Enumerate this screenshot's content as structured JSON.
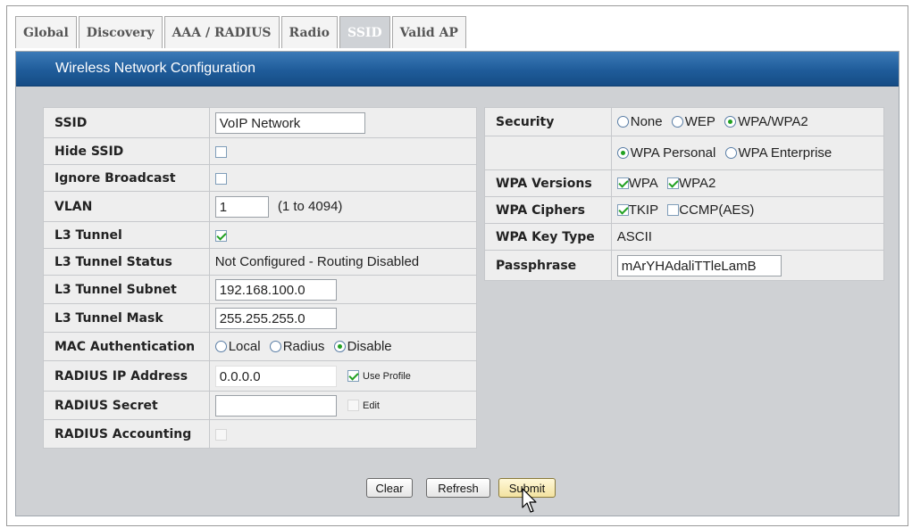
{
  "tabs": [
    {
      "label": "Global",
      "active": false
    },
    {
      "label": "Discovery",
      "active": false
    },
    {
      "label": "AAA / RADIUS",
      "active": false
    },
    {
      "label": "Radio",
      "active": false
    },
    {
      "label": "SSID",
      "active": true
    },
    {
      "label": "Valid AP",
      "active": false
    }
  ],
  "panel_title": "Wireless Network Configuration",
  "left": {
    "ssid": {
      "label": "SSID",
      "value": "VoIP Network"
    },
    "hide_ssid": {
      "label": "Hide SSID",
      "checked": false
    },
    "ignore_broadcast": {
      "label": "Ignore Broadcast",
      "checked": false
    },
    "vlan": {
      "label": "VLAN",
      "value": "1",
      "range": "(1 to 4094)"
    },
    "l3_tunnel": {
      "label": "L3 Tunnel",
      "checked": true
    },
    "l3_tunnel_status": {
      "label": "L3 Tunnel Status",
      "value": "Not Configured - Routing Disabled"
    },
    "l3_tunnel_subnet": {
      "label": "L3 Tunnel Subnet",
      "value": "192.168.100.0"
    },
    "l3_tunnel_mask": {
      "label": "L3 Tunnel Mask",
      "value": "255.255.255.0"
    },
    "mac_auth": {
      "label": "MAC Authentication",
      "options": [
        "Local",
        "Radius",
        "Disable"
      ],
      "selected": "Disable"
    },
    "radius_ip": {
      "label": "RADIUS IP Address",
      "value": "0.0.0.0",
      "use_profile_label": "Use Profile",
      "use_profile_checked": true
    },
    "radius_secret": {
      "label": "RADIUS Secret",
      "value": "",
      "edit_label": "Edit",
      "edit_checked": false
    },
    "radius_accounting": {
      "label": "RADIUS Accounting",
      "checked": false
    }
  },
  "right": {
    "security": {
      "label": "Security",
      "options": [
        "None",
        "WEP",
        "WPA/WPA2"
      ],
      "selected": "WPA/WPA2",
      "modes": [
        "WPA Personal",
        "WPA Enterprise"
      ],
      "mode_selected": "WPA Personal"
    },
    "wpa_versions": {
      "label": "WPA Versions",
      "options": [
        {
          "label": "WPA",
          "checked": true
        },
        {
          "label": "WPA2",
          "checked": true
        }
      ]
    },
    "wpa_ciphers": {
      "label": "WPA Ciphers",
      "options": [
        {
          "label": "TKIP",
          "checked": true
        },
        {
          "label": "CCMP(AES)",
          "checked": false
        }
      ]
    },
    "wpa_key_type": {
      "label": "WPA Key Type",
      "value": "ASCII"
    },
    "passphrase": {
      "label": "Passphrase",
      "value": "mArYHAdaliTTleLamB"
    }
  },
  "buttons": {
    "clear": "Clear",
    "refresh": "Refresh",
    "submit": "Submit"
  },
  "colors": {
    "accent": "#1f5c9a",
    "panel_bg": "#cfd1d4",
    "check": "#21a121"
  }
}
